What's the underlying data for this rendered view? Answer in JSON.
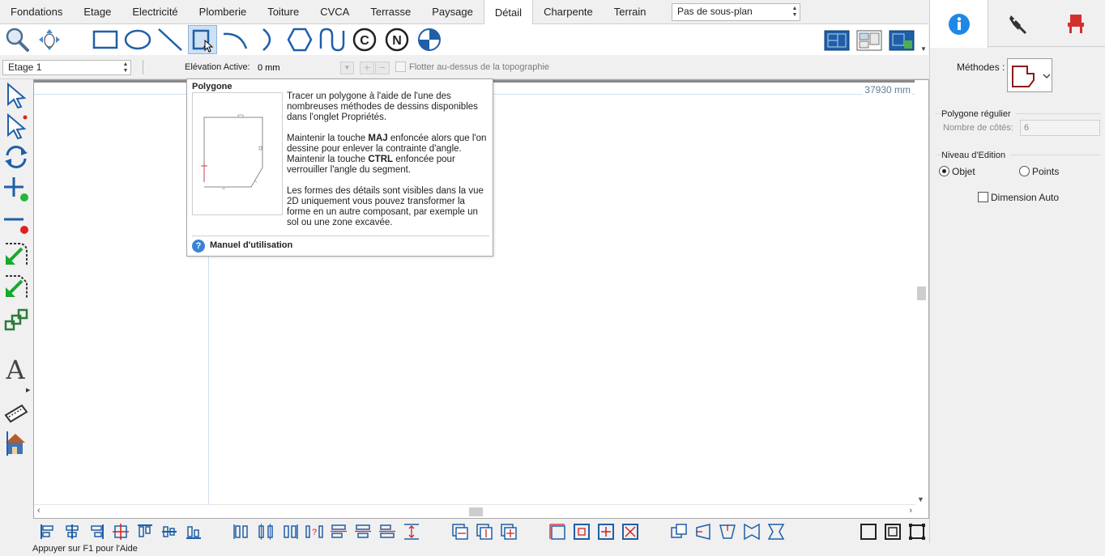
{
  "tabs": [
    "Fondations",
    "Etage",
    "Electricité",
    "Plomberie",
    "Toiture",
    "CVCA",
    "Terrasse",
    "Paysage",
    "Détail",
    "Charpente",
    "Terrain"
  ],
  "active_tab": "Détail",
  "plan_select": {
    "value": "Pas de sous-plan"
  },
  "options": {
    "floor": "Etage 1",
    "elevation_label": "Elévation Active:",
    "elevation_value": "0 mm",
    "plus": "+",
    "minus": "−",
    "float_label": "Flotter au-dessus de la topographie"
  },
  "canvas": {
    "dimension": "37930 mm"
  },
  "tooltip": {
    "title": "Polygone",
    "para1": "Tracer un polygone à l'aide de l'une des nombreuses méthodes de dessins disponibles dans l'onglet Propriétés.",
    "para2_pre": "Maintenir la touche ",
    "para2_key1": "MAJ",
    "para2_mid": " enfoncée alors que l'on dessine pour enlever la contrainte d'angle. Maintenir la touche ",
    "para2_key2": "CTRL",
    "para2_post": " enfoncée pour verrouiller l'angle du segment.",
    "para3": "Les formes des détails sont visibles dans la vue 2D uniquement vous pouvez transformer la forme en un autre composant, par exemple un sol ou une zone excavée.",
    "help_icon": "?",
    "help_label": "Manuel d'utilisation"
  },
  "right_panel": {
    "methods_label": "Méthodes :",
    "regular_polygon_title": "Polygone régulier",
    "sides_label": "Nombre de côtés:",
    "sides_value": "6",
    "edit_level_title": "Niveau d'Edition",
    "radio_object": "Objet",
    "radio_points": "Points",
    "auto_dimension": "Dimension Auto"
  },
  "status": "Appuyer sur F1 pour l'Aide",
  "colors": {
    "accent_blue": "#1e88e5",
    "tool_blue": "#1f5fa8",
    "tooltip_help": "#3a83d5"
  }
}
